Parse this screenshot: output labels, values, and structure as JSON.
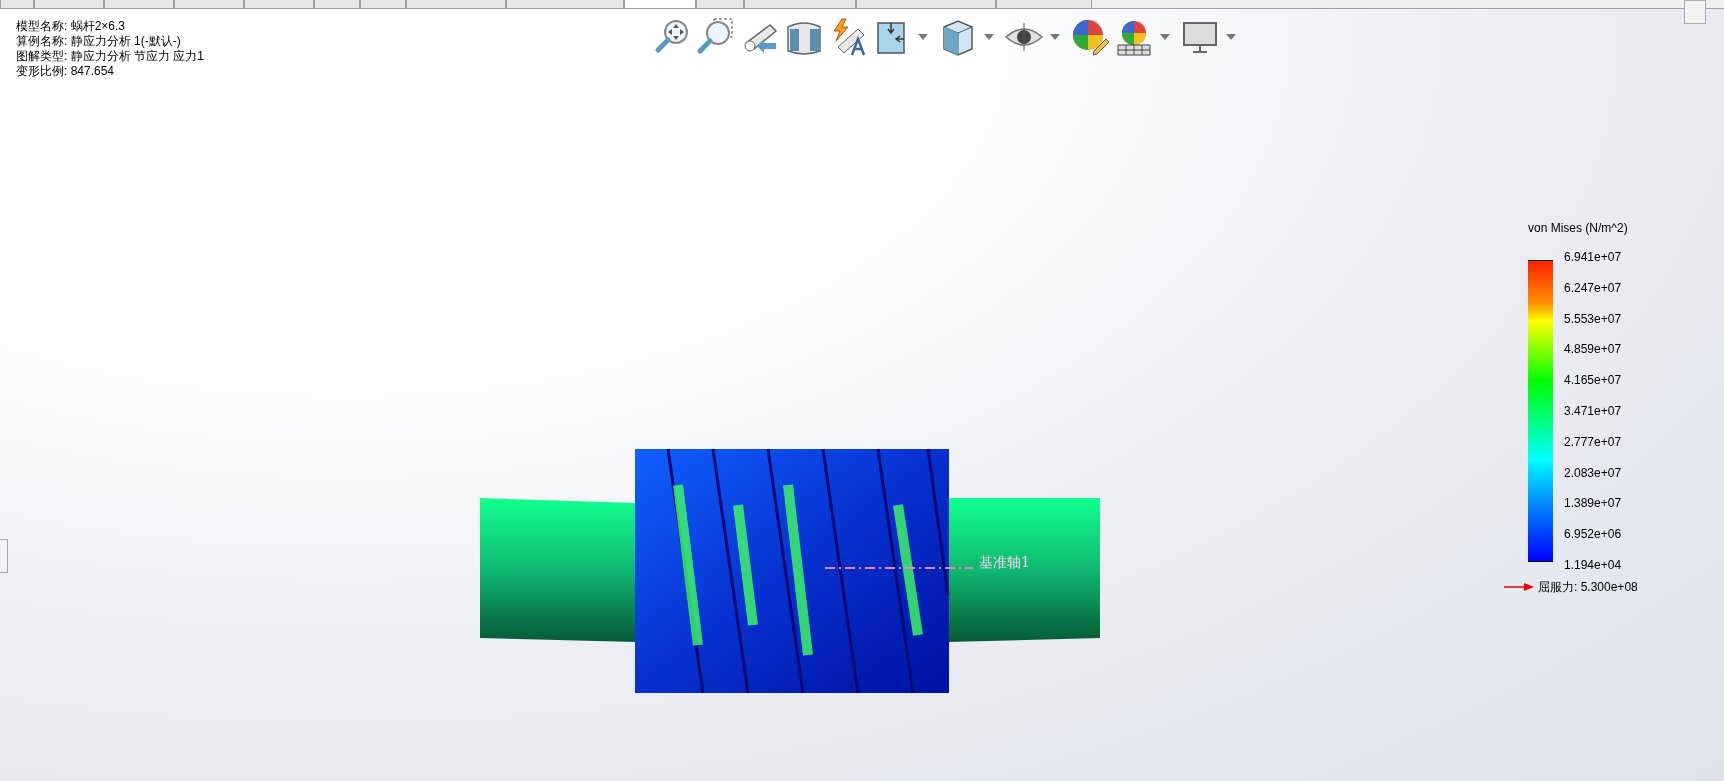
{
  "tabs": [
    {
      "selected": false
    },
    {
      "selected": false
    },
    {
      "selected": false
    },
    {
      "selected": false
    },
    {
      "selected": false
    },
    {
      "selected": false
    },
    {
      "selected": false
    },
    {
      "selected": false
    },
    {
      "selected": false
    },
    {
      "selected": true
    },
    {
      "selected": false
    },
    {
      "selected": false
    },
    {
      "selected": false
    },
    {
      "selected": false
    }
  ],
  "info": [
    "模型名称: 蜗杆2×6.3",
    "算例名称: 静应力分析 1(-默认-)",
    "图解类型: 静应力分析 节应力 应力1",
    "变形比例: 847.654"
  ],
  "toolbar": [
    {
      "dropdown": false
    },
    {
      "dropdown": false
    },
    {
      "dropdown": false
    },
    {
      "dropdown": false
    },
    {
      "dropdown": false
    },
    {
      "dropdown": true
    },
    {
      "dropdown": true
    },
    {
      "dropdown": true
    },
    {
      "dropdown": false
    },
    {
      "dropdown": true
    },
    {
      "dropdown": true
    }
  ],
  "legend": {
    "title": "von Mises (N/m^2)",
    "values": [
      "6.941e+07",
      "6.247e+07",
      "5.553e+07",
      "4.859e+07",
      "4.165e+07",
      "3.471e+07",
      "2.777e+07",
      "2.083e+07",
      "1.389e+07",
      "6.952e+06",
      "1.194e+04"
    ],
    "yield": "屈服力: 5.300e+08"
  },
  "axis_label": "基准轴1"
}
